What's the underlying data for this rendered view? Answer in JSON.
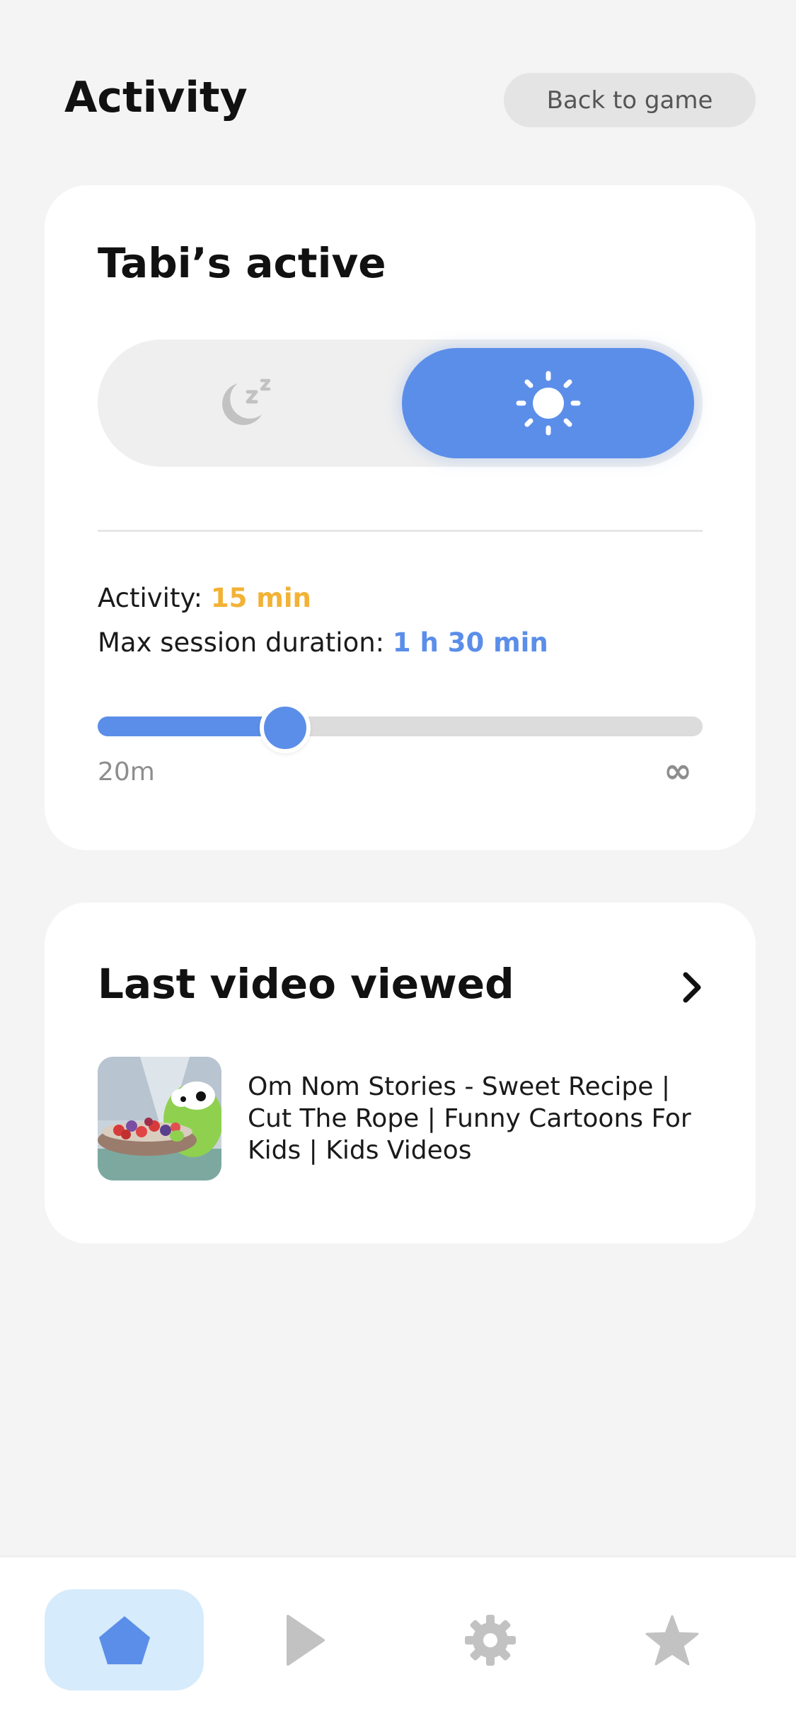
{
  "header": {
    "title": "Activity",
    "back_button_label": "Back to game"
  },
  "status_card": {
    "title": "Tabi’s active",
    "mode_toggle": {
      "options": [
        "sleep",
        "active"
      ],
      "selected": "active",
      "sleep_icon": "moon-zzz-icon",
      "active_icon": "sun-icon"
    },
    "activity_label": "Activity:",
    "activity_value": "15 min",
    "session_label": "Max session duration:",
    "session_value": "1 h 30 min",
    "slider": {
      "level_fraction": 0.31,
      "min_label": "20m",
      "max_label": "∞"
    }
  },
  "video_card": {
    "title": "Last video viewed",
    "chevron_icon": "chevron-right-icon",
    "video": {
      "title": "Om Nom Stories - Sweet Recipe | Cut The Rope | Funny Cartoons For Kids | Kids Videos"
    }
  },
  "bottom_nav": {
    "items": [
      {
        "name": "home",
        "icon": "home-icon",
        "active": true
      },
      {
        "name": "play",
        "icon": "play-icon",
        "active": false
      },
      {
        "name": "settings",
        "icon": "gear-icon",
        "active": false
      },
      {
        "name": "favorites",
        "icon": "star-icon",
        "active": false
      }
    ]
  },
  "colors": {
    "accent_blue": "#5b8ee9",
    "accent_orange": "#f2b236",
    "nav_active_bg": "#d6ebfb",
    "background": "#f4f4f4",
    "icon_inactive": "#c2c2c2"
  }
}
